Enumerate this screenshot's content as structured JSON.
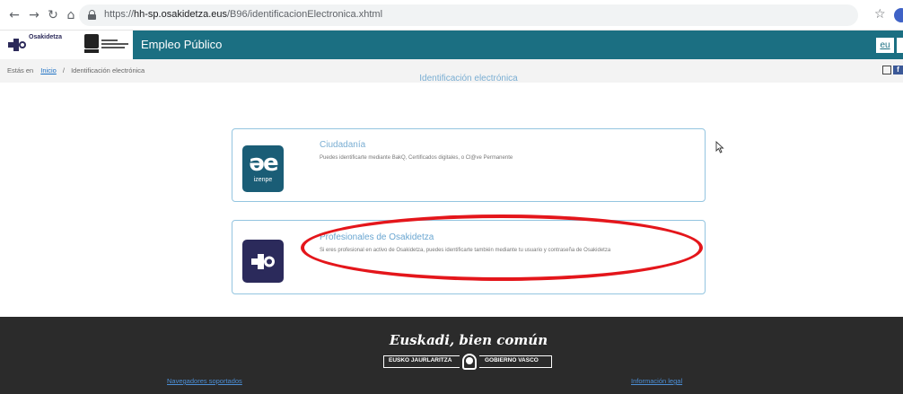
{
  "browser": {
    "back_icon": "←",
    "forward_icon": "→",
    "reload_icon": "↻",
    "home_icon": "⌂",
    "url_prefix": "https://",
    "url_host": "hh-sp.osakidetza.eus",
    "url_path": "/B96/identificacionElectronica.xhtml",
    "star_icon": "☆"
  },
  "header": {
    "org_name": "Osakidetza",
    "site_title": "Empleo Público",
    "lang_label": "eu",
    "brand_color": "#1b6f82"
  },
  "breadcrumb": {
    "prefix": "Estás en",
    "home": "Inicio",
    "separator": "/",
    "current": "Identificación electrónica",
    "facebook_glyph": "f"
  },
  "main": {
    "title": "Identificación electrónica",
    "cards": [
      {
        "logo_glyph": "əe",
        "logo_label": "izenpe",
        "title": "Ciudadanía",
        "description": "Puedes identificarte mediante BakQ, Certificados digitales, o Cl@ve Permanente",
        "logo_color": "#1a5d76"
      },
      {
        "title": "Profesionales de Osakidetza",
        "description": "Si eres profesional en activo de Osakidetza, puedes identificarte también mediante tu usuario y contraseña de Osakidetza",
        "logo_color": "#2b2a5b"
      }
    ],
    "highlight_color": "#e4161b"
  },
  "footer": {
    "tagline": "Euskadi, bien común",
    "badge_left": "EUSKO JAURLARITZA",
    "badge_right": "GOBIERNO VASCO",
    "link_left": "Navegadores soportados",
    "link_right": "Información legal"
  }
}
